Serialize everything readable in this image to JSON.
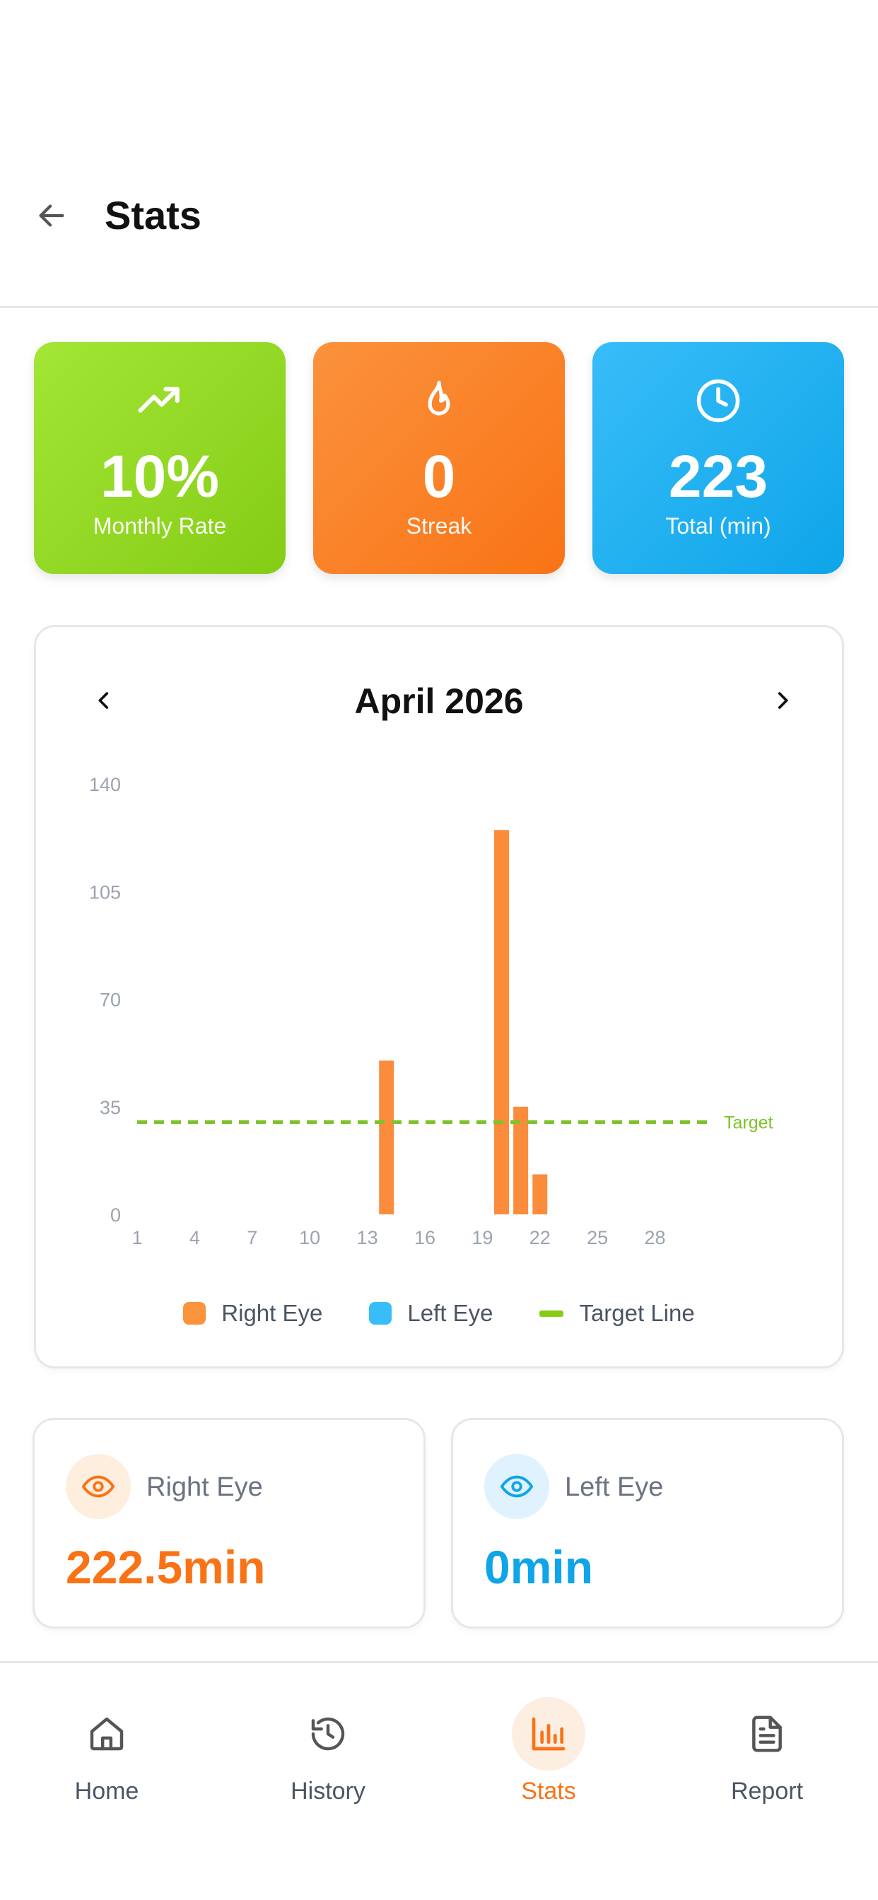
{
  "header": {
    "title": "Stats",
    "back_icon": "arrow-left-icon"
  },
  "stats": [
    {
      "value": "10%",
      "label": "Monthly Rate",
      "icon": "trending-up-icon",
      "color": "#84cc16"
    },
    {
      "value": "0",
      "label": "Streak",
      "icon": "flame-icon",
      "color": "#f97316"
    },
    {
      "value": "223",
      "label": "Total (min)",
      "icon": "clock-icon",
      "color": "#0ea5e9"
    }
  ],
  "chart": {
    "month_label": "April 2026",
    "prev_icon": "chevron-left-icon",
    "next_icon": "chevron-right-icon"
  },
  "chart_data": {
    "type": "bar",
    "x": [
      14,
      20,
      21,
      22
    ],
    "series": [
      {
        "name": "Right Eye",
        "color": "#fb8c3c",
        "values": [
          50,
          125,
          35,
          13
        ]
      },
      {
        "name": "Left Eye",
        "color": "#38bdf8",
        "values": [
          0,
          0,
          0,
          0
        ]
      }
    ],
    "xlim": [
      1,
      30
    ],
    "x_ticks": [
      "1",
      "4",
      "7",
      "10",
      "13",
      "16",
      "19",
      "22",
      "25",
      "28"
    ],
    "x_tick_values": [
      1,
      4,
      7,
      10,
      13,
      16,
      19,
      22,
      25,
      28
    ],
    "ylim": [
      0,
      140
    ],
    "y_ticks": [
      "0",
      "35",
      "70",
      "105",
      "140"
    ],
    "target": {
      "value": 30,
      "label": "Target",
      "color": "#7cc22a"
    },
    "grid": false,
    "legend": {
      "position": "bottom",
      "items": [
        {
          "label": "Right Eye",
          "color": "#fb8c3c",
          "shape": "square"
        },
        {
          "label": "Left Eye",
          "color": "#38bdf8",
          "shape": "square"
        },
        {
          "label": "Target Line",
          "color": "#84cc16",
          "shape": "line"
        }
      ]
    }
  },
  "eyes": {
    "right": {
      "label": "Right Eye",
      "value": "222.5min",
      "color": "#f97316",
      "icon": "eye-icon"
    },
    "left": {
      "label": "Left Eye",
      "value": "0min",
      "color": "#0ea5e9",
      "icon": "eye-icon"
    }
  },
  "nav": {
    "items": [
      {
        "label": "Home",
        "icon": "home-icon",
        "active": false
      },
      {
        "label": "History",
        "icon": "history-icon",
        "active": false
      },
      {
        "label": "Stats",
        "icon": "bar-chart-icon",
        "active": true
      },
      {
        "label": "Report",
        "icon": "report-icon",
        "active": false
      }
    ]
  }
}
